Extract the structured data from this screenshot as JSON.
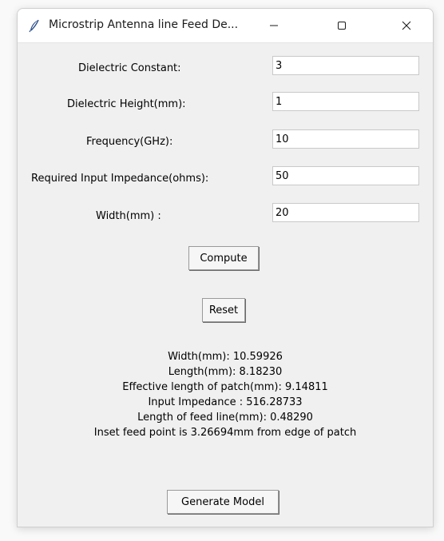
{
  "window": {
    "title": "Microstrip Antenna line Feed De..."
  },
  "form": {
    "fields": [
      {
        "label": "Dielectric Constant:",
        "value": "3"
      },
      {
        "label": "Dielectric Height(mm):",
        "value": "1"
      },
      {
        "label": "Frequency(GHz):",
        "value": "10"
      },
      {
        "label": "Required Input Impedance(ohms):",
        "value": "50"
      },
      {
        "label": "Width(mm) :",
        "value": "20"
      }
    ]
  },
  "buttons": {
    "compute": "Compute",
    "reset": "Reset",
    "generate": "Generate Model"
  },
  "results": [
    "Width(mm): 10.59926",
    "Length(mm): 8.18230",
    "Effective length of patch(mm): 9.14811",
    "Input Impedance : 516.28733",
    "Length of feed line(mm): 0.48290",
    "Inset feed point is 3.26694mm from edge of patch"
  ],
  "icons": {
    "app": "feather-icon",
    "minimize": "minimize-icon",
    "maximize": "maximize-icon",
    "close": "close-icon"
  }
}
